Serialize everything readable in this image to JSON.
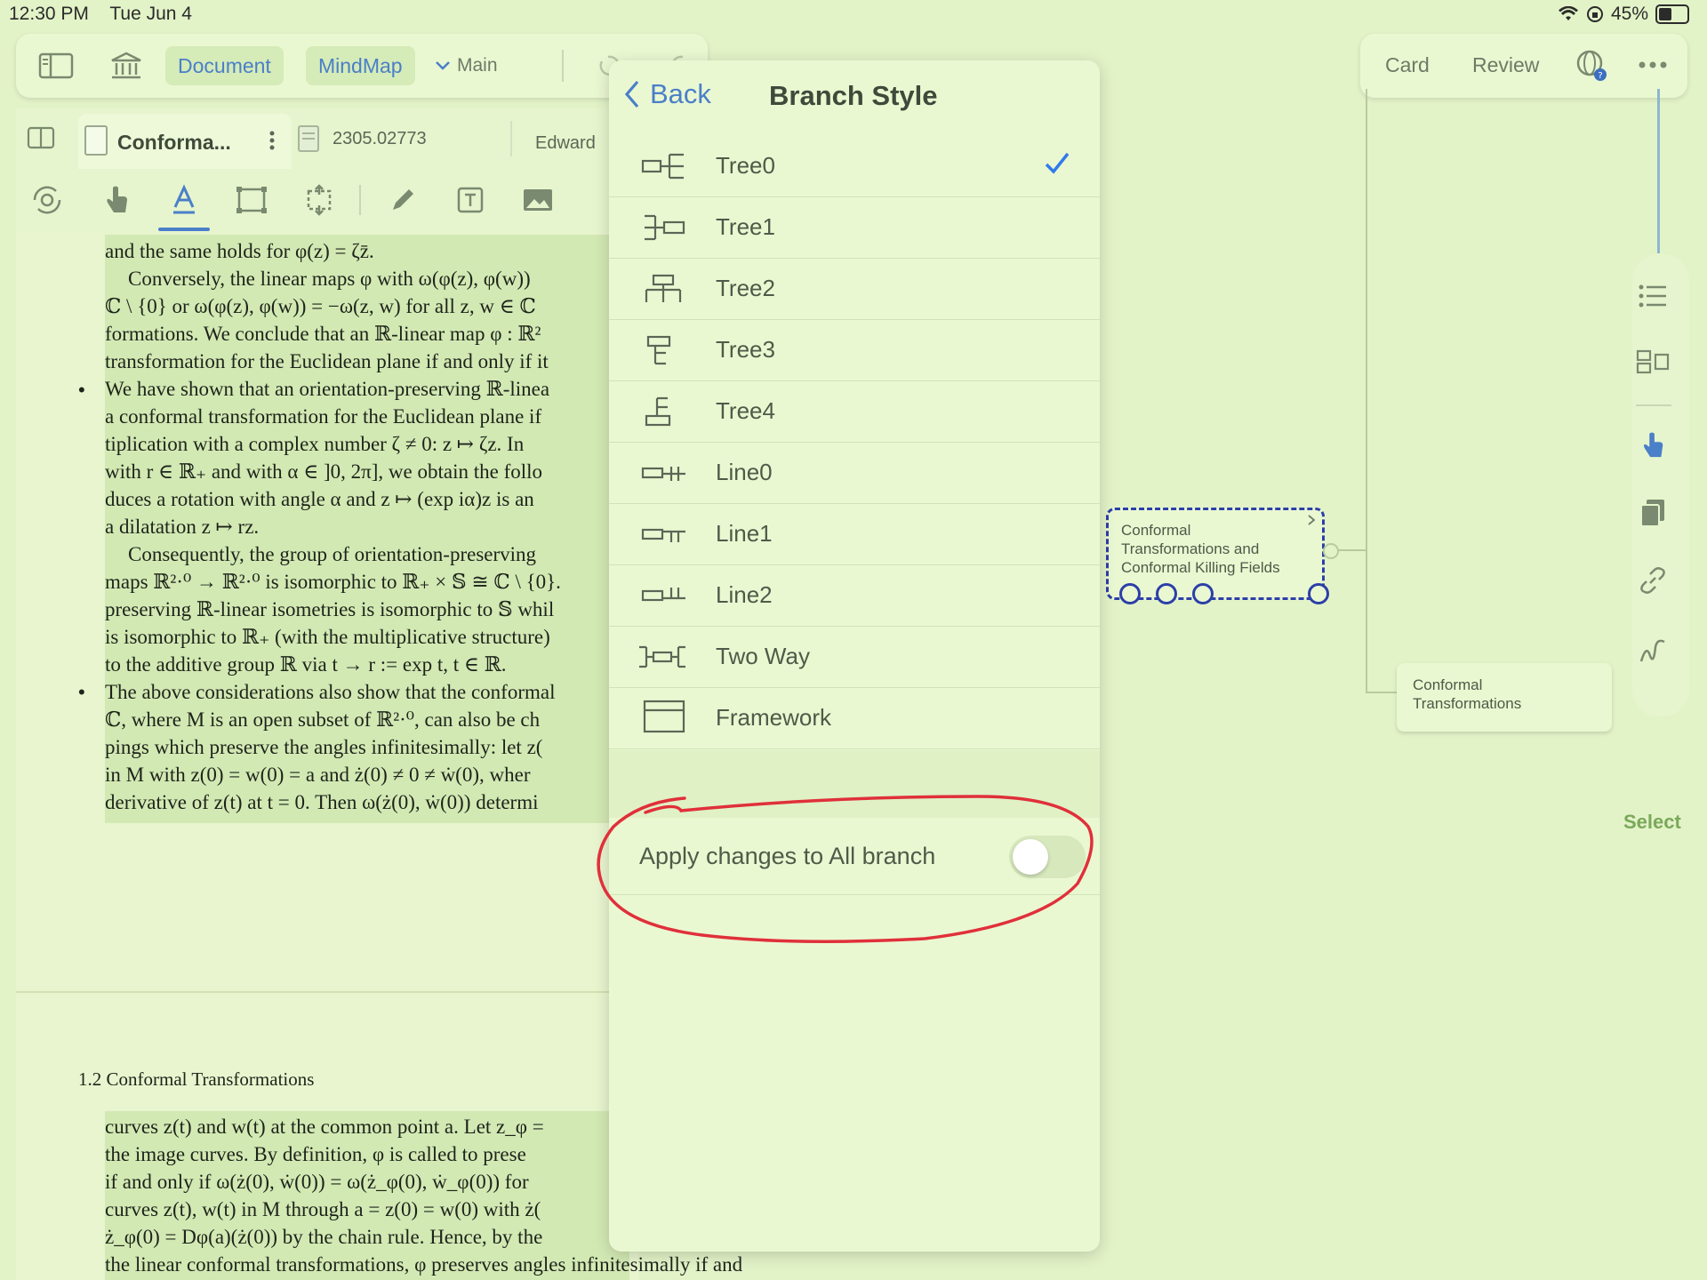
{
  "status": {
    "time": "12:30 PM",
    "date": "Tue Jun 4",
    "battery": "45%"
  },
  "toolbar": {
    "document": "Document",
    "mindmap": "MindMap",
    "main": "Main"
  },
  "right_toolbar": {
    "card": "Card",
    "review": "Review"
  },
  "tabs": [
    {
      "label": "Conforma..."
    },
    {
      "label": "2305.02773"
    },
    {
      "label": "Edward"
    }
  ],
  "document": {
    "lines_top": [
      "and the same holds for φ(z) = ζz̄.",
      "Conversely, the linear maps φ with ω(φ(z), φ(w))",
      "ℂ \\ {0} or ω(φ(z), φ(w)) = −ω(z, w) for all z, w ∈ ℂ",
      "formations. We conclude that an ℝ-linear map φ : ℝ²",
      "transformation for the Euclidean plane if and only if it",
      "We have shown that an orientation-preserving ℝ-linea",
      "a conformal transformation for the Euclidean plane if",
      "tiplication with a complex number ζ ≠ 0: z ↦ ζz. In",
      "with r ∈ ℝ₊ and with α ∈ ]0, 2π], we obtain the follo",
      "duces a rotation with angle α and z ↦ (exp iα)z is an",
      "a dilatation z ↦ rz.",
      "Consequently, the group of orientation-preserving",
      "maps ℝ²·⁰ → ℝ²·⁰ is isomorphic to ℝ₊ × 𝕊 ≅ ℂ \\ {0}.",
      "preserving ℝ-linear isometries is isomorphic to 𝕊 whil",
      "is isomorphic to ℝ₊ (with the multiplicative structure)",
      "to the additive group ℝ via t → r := exp t, t ∈ ℝ.",
      "The above considerations also show that the conformal",
      "ℂ, where M is an open subset of ℝ²·⁰, can also be ch",
      "pings which preserve the angles infinitesimally: let z(",
      "in M with z(0) = w(0) = a and ż(0) ≠ 0 ≠ ẇ(0), wher",
      "derivative of z(t) at t = 0. Then ω(ż(0), ẇ(0)) determi"
    ],
    "section_title": "1.2  Conformal Transformations",
    "lines_bottom": [
      "curves z(t) and w(t) at the common point a. Let z_φ =",
      "the image curves. By definition, φ is called to prese",
      "if and only if ω(ż(0), ẇ(0)) = ω(ż_φ(0), ẇ_φ(0)) for",
      "curves z(t), w(t) in M through a = z(0) = w(0) with ż(",
      "ż_φ(0) = Dφ(a)(ż(0)) by the chain rule. Hence, by the",
      "the linear conformal transformations, φ preserves angles infinitesimally if and"
    ]
  },
  "popup": {
    "back": "Back",
    "title": "Branch Style",
    "options": [
      "Tree0",
      "Tree1",
      "Tree2",
      "Tree3",
      "Tree4",
      "Line0",
      "Line1",
      "Line2",
      "Two Way",
      "Framework"
    ],
    "selected": "Tree0",
    "apply_label": "Apply changes to All branch",
    "apply_on": false
  },
  "mindmap": {
    "selected_node": [
      "Conformal",
      "Transformations and",
      "Conformal Killing Fields"
    ],
    "child_node": [
      "Conformal",
      "Transformations"
    ],
    "select_label": "Select"
  },
  "colors": {
    "accent": "#4a7fc9",
    "background": "#e3f3c8",
    "annotation": "#e0303a",
    "node_border": "#2c3fa8"
  }
}
